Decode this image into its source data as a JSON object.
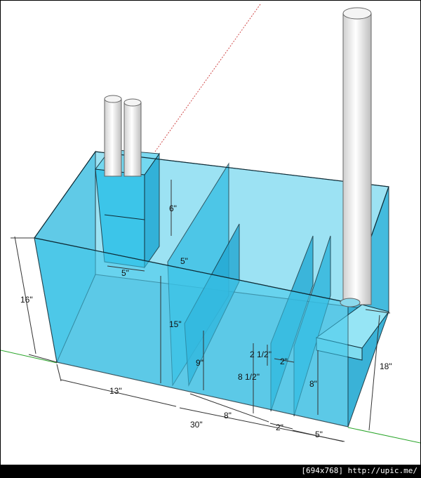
{
  "dimensions": {
    "overall_length": "30\"",
    "height": "16\"",
    "right_height": "18\"",
    "left_section": "13\"",
    "middle_section": "8\"",
    "gap_section": "2\"",
    "right_section": "5\"",
    "baffle_height": "15\"",
    "low_baffle": "9\"",
    "mid_baffle": "8 1/2\"",
    "right_baffle": "8\"",
    "top_gap": "2 1/2\"",
    "inner_gap": "2\"",
    "overflow_box_height": "6\"",
    "overflow_box_width": "5\"",
    "slot_width": "5\""
  },
  "footer": {
    "text": "[694x768]  http://upic.me/"
  },
  "colors": {
    "water": "#34c3e6",
    "water_dark": "#1aa5cc",
    "edge": "#0d2b36",
    "pipe": "#f2f2f2",
    "ground": "#2aa52a"
  }
}
